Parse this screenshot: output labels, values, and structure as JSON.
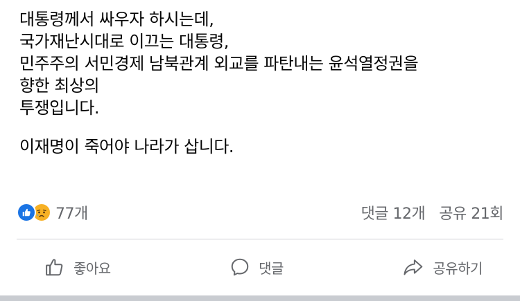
{
  "post": {
    "lines": [
      "대통령께서 싸우자 하시는데,",
      "국가재난시대로 이끄는 대통령,",
      "민주주의 서민경제 남북관계 외교를 파탄내는 윤석열정권을",
      "향한 최상의",
      "투쟁입니다.",
      "",
      "이재명이 죽어야 나라가 삽니다."
    ]
  },
  "reactions": {
    "icons": [
      "like-icon",
      "sad-face-icon"
    ],
    "count": "77개"
  },
  "stats": {
    "comments": "댓글 12개",
    "shares": "공유 21회"
  },
  "actions": {
    "like_label": "좋아요",
    "comment_label": "댓글",
    "share_label": "공유하기"
  },
  "colors": {
    "text": "#050505",
    "secondary": "#65676b",
    "like_blue": "#1b74e4",
    "sad_yellow": "#f7b125",
    "divider": "#ced0d4"
  }
}
